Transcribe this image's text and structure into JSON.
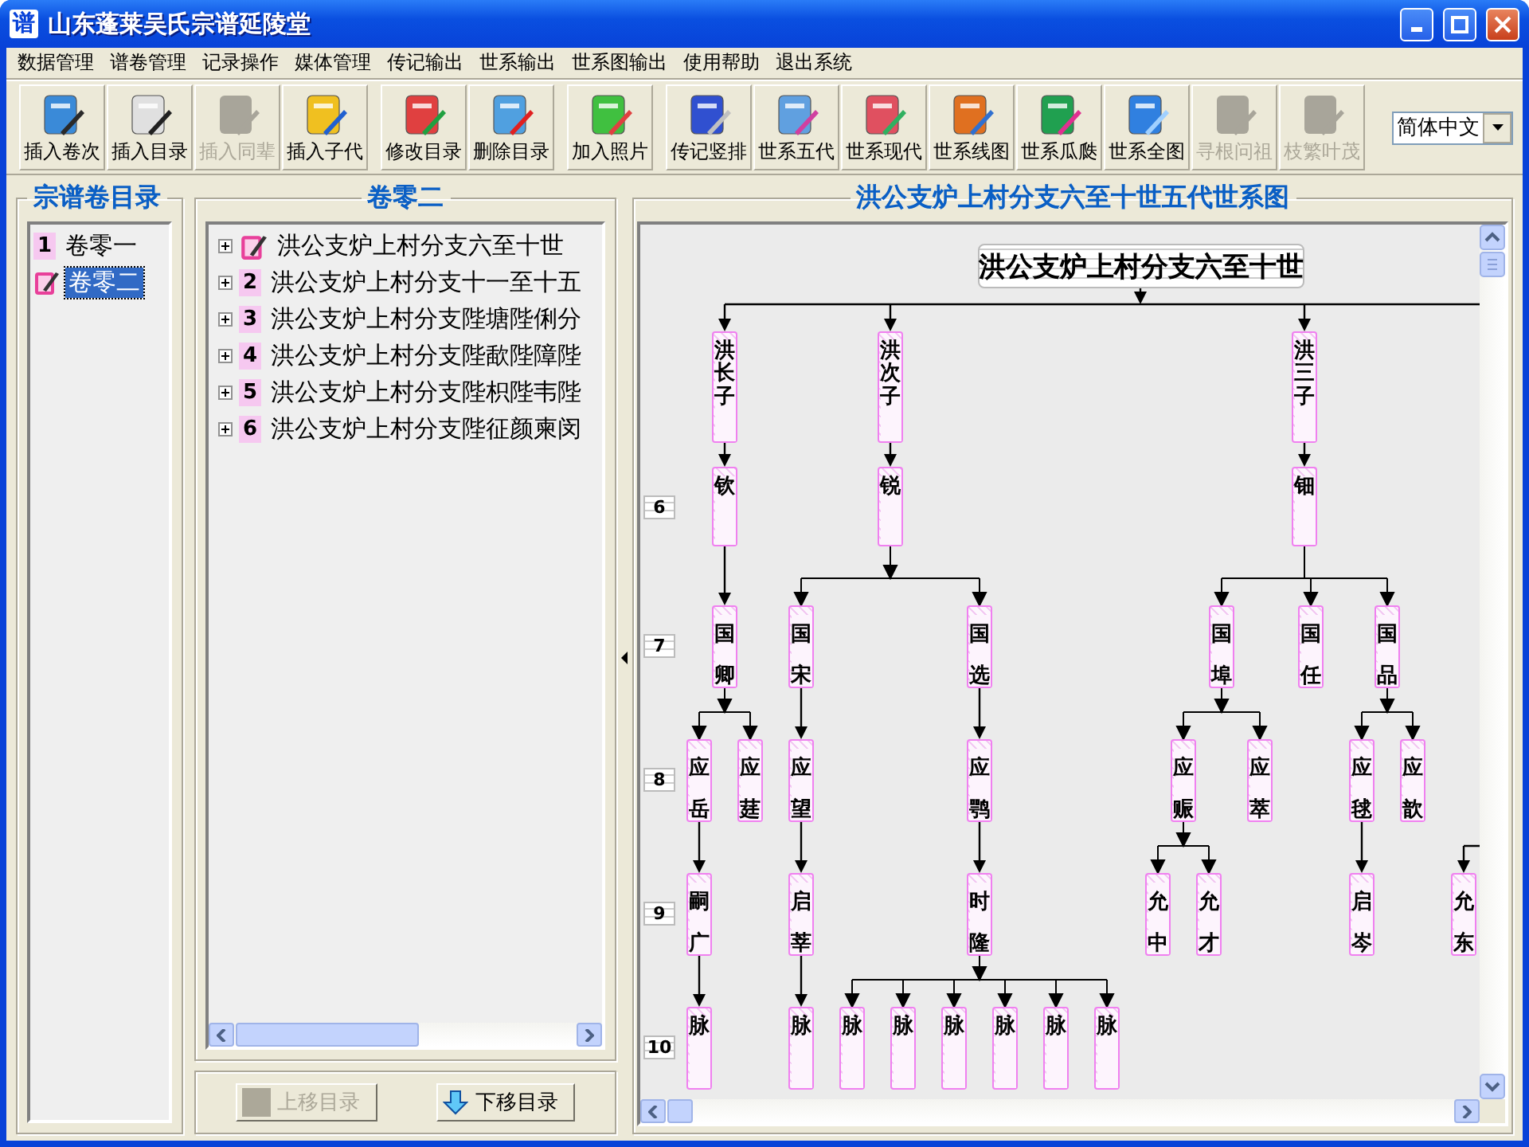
{
  "window": {
    "icon": "谱",
    "title": "山东蓬莱吴氏宗谱延陵堂"
  },
  "menu": [
    "数据管理",
    "谱卷管理",
    "记录操作",
    "媒体管理",
    "传记输出",
    "世系输出",
    "世系图输出",
    "使用帮助",
    "退出系统"
  ],
  "toolbar": [
    {
      "buttons": [
        {
          "label": "插入卷次",
          "disabled": false
        },
        {
          "label": "插入目录",
          "disabled": false
        },
        {
          "label": "插入同辈",
          "disabled": true
        },
        {
          "label": "插入子代",
          "disabled": false
        }
      ]
    },
    {
      "buttons": [
        {
          "label": "修改目录",
          "disabled": false
        },
        {
          "label": "删除目录",
          "disabled": false
        }
      ]
    },
    {
      "buttons": [
        {
          "label": "加入照片",
          "disabled": false
        }
      ]
    },
    {
      "buttons": [
        {
          "label": "传记竖排",
          "disabled": false
        },
        {
          "label": "世系五代",
          "disabled": false
        },
        {
          "label": "世系现代",
          "disabled": false
        },
        {
          "label": "世系线图",
          "disabled": false
        },
        {
          "label": "世系瓜瓞",
          "disabled": false
        },
        {
          "label": "世系全图",
          "disabled": false
        },
        {
          "label": "寻根问祖",
          "disabled": true
        },
        {
          "label": "枝繁叶茂",
          "disabled": true
        }
      ]
    }
  ],
  "language": {
    "value": "简体中文"
  },
  "volume_panel": {
    "title": "宗谱卷目录",
    "items": [
      {
        "number": "1",
        "label": "卷零一",
        "selected": false
      },
      {
        "label": "卷零二",
        "selected": true
      }
    ]
  },
  "chapter_panel": {
    "title": "卷零二",
    "items": [
      {
        "label": "洪公支炉上村分支六至十世",
        "selected": true,
        "expanded": false
      },
      {
        "number": "2",
        "label": "洪公支炉上村分支十一至十五",
        "selected": false,
        "expanded": false
      },
      {
        "number": "3",
        "label": "洪公支炉上村分支陛塘陛俐分",
        "selected": false,
        "expanded": false
      },
      {
        "number": "4",
        "label": "洪公支炉上村分支陛歃陛障陛",
        "selected": false,
        "expanded": false
      },
      {
        "number": "5",
        "label": "洪公支炉上村分支陛枳陛韦陛",
        "selected": false,
        "expanded": false
      },
      {
        "number": "6",
        "label": "洪公支炉上村分支陛征颜柬闵",
        "selected": false,
        "expanded": false
      }
    ]
  },
  "move_buttons": [
    {
      "label": "上移目录",
      "disabled": true
    },
    {
      "label": "下移目录",
      "disabled": false
    }
  ],
  "chart_panel": {
    "title": "洪公支炉上村分支六至十世五代世系图",
    "generations": [
      "6",
      "7",
      "8",
      "9",
      "10"
    ],
    "root": {
      "name": "洪公支炉上村分支六至十世",
      "children": [
        {
          "name": "洪长子",
          "children": [
            {
              "name": "钦",
              "children": [
                {
                  "name": "国卿",
                  "children": [
                    {
                      "name": "应岳",
                      "children": [
                        {
                          "name": "嗣广",
                          "children": [
                            {
                              "name": "脉"
                            }
                          ]
                        }
                      ]
                    },
                    {
                      "name": "应莛"
                    }
                  ]
                }
              ]
            }
          ]
        },
        {
          "name": "洪次子",
          "children": [
            {
              "name": "锐",
              "children": [
                {
                  "name": "国宋",
                  "children": [
                    {
                      "name": "应望",
                      "children": [
                        {
                          "name": "启莘",
                          "children": [
                            {
                              "name": "脉"
                            }
                          ]
                        }
                      ]
                    }
                  ]
                },
                {
                  "name": "国选",
                  "children": [
                    {
                      "name": "应鹗",
                      "children": [
                        {
                          "name": "时隆",
                          "children": [
                            {
                              "name": "脉"
                            },
                            {
                              "name": "脉"
                            },
                            {
                              "name": "脉"
                            },
                            {
                              "name": "脉"
                            },
                            {
                              "name": "脉"
                            },
                            {
                              "name": "脉"
                            }
                          ]
                        }
                      ]
                    }
                  ]
                }
              ]
            }
          ]
        },
        {
          "name": "洪三子",
          "children": [
            {
              "name": "钿",
              "children": [
                {
                  "name": "国埠",
                  "children": [
                    {
                      "name": "应赈",
                      "children": [
                        {
                          "name": "允中"
                        },
                        {
                          "name": "允才"
                        }
                      ]
                    },
                    {
                      "name": "应萃"
                    }
                  ]
                },
                {
                  "name": "国任"
                },
                {
                  "name": "国品",
                  "children": [
                    {
                      "name": "应毬",
                      "children": [
                        {
                          "name": "启岑"
                        }
                      ]
                    },
                    {
                      "name": "应歆"
                    }
                  ]
                }
              ]
            }
          ]
        }
      ]
    },
    "edge_nodes": [
      {
        "name": "允东"
      }
    ]
  }
}
